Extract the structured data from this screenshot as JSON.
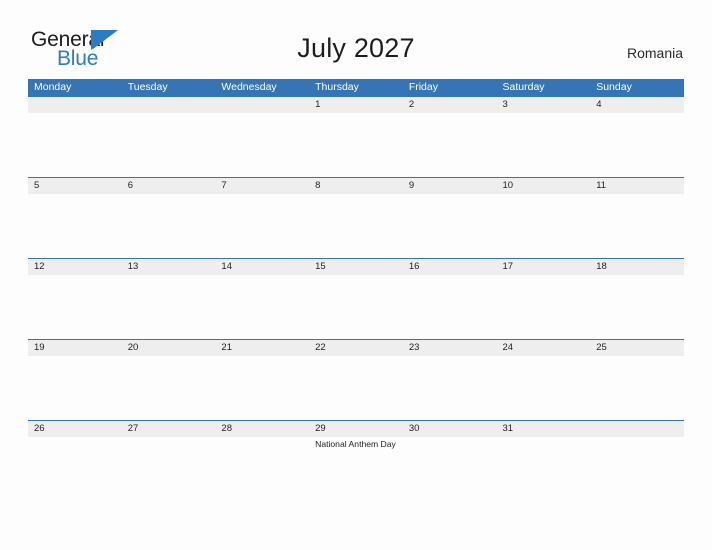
{
  "logo": {
    "word_one": "General",
    "word_two": "Blue",
    "flag_color": "#2b7cc0"
  },
  "header": {
    "title": "July 2027",
    "region": "Romania"
  },
  "theme": {
    "header_blue": "#3575b5",
    "row_band": "#eeeeee",
    "page_background": "#fdfdfd",
    "text": "#1f1f1f"
  },
  "calendar": {
    "weekdays": [
      "Monday",
      "Tuesday",
      "Wednesday",
      "Thursday",
      "Friday",
      "Saturday",
      "Sunday"
    ],
    "weeks": [
      {
        "days": [
          {
            "date": "",
            "events": []
          },
          {
            "date": "",
            "events": []
          },
          {
            "date": "",
            "events": []
          },
          {
            "date": "1",
            "events": []
          },
          {
            "date": "2",
            "events": []
          },
          {
            "date": "3",
            "events": []
          },
          {
            "date": "4",
            "events": []
          }
        ]
      },
      {
        "days": [
          {
            "date": "5",
            "events": []
          },
          {
            "date": "6",
            "events": []
          },
          {
            "date": "7",
            "events": []
          },
          {
            "date": "8",
            "events": []
          },
          {
            "date": "9",
            "events": []
          },
          {
            "date": "10",
            "events": []
          },
          {
            "date": "11",
            "events": []
          }
        ]
      },
      {
        "days": [
          {
            "date": "12",
            "events": []
          },
          {
            "date": "13",
            "events": []
          },
          {
            "date": "14",
            "events": []
          },
          {
            "date": "15",
            "events": []
          },
          {
            "date": "16",
            "events": []
          },
          {
            "date": "17",
            "events": []
          },
          {
            "date": "18",
            "events": []
          }
        ]
      },
      {
        "days": [
          {
            "date": "19",
            "events": []
          },
          {
            "date": "20",
            "events": []
          },
          {
            "date": "21",
            "events": []
          },
          {
            "date": "22",
            "events": []
          },
          {
            "date": "23",
            "events": []
          },
          {
            "date": "24",
            "events": []
          },
          {
            "date": "25",
            "events": []
          }
        ]
      },
      {
        "days": [
          {
            "date": "26",
            "events": []
          },
          {
            "date": "27",
            "events": []
          },
          {
            "date": "28",
            "events": []
          },
          {
            "date": "29",
            "events": [
              "National Anthem Day"
            ]
          },
          {
            "date": "30",
            "events": []
          },
          {
            "date": "31",
            "events": []
          },
          {
            "date": "",
            "events": []
          }
        ]
      }
    ]
  }
}
